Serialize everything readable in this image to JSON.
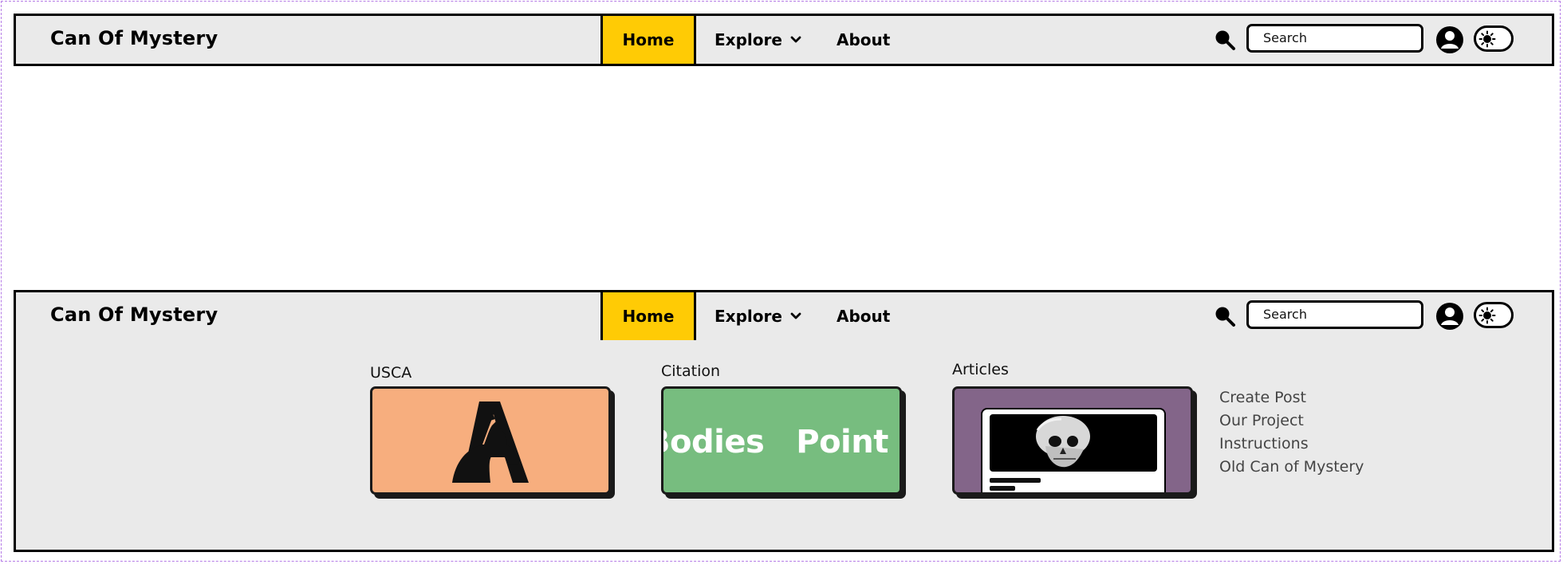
{
  "brand": "Can Of Mystery",
  "nav": {
    "home": "Home",
    "explore": "Explore",
    "about": "About"
  },
  "search": {
    "placeholder": "Search"
  },
  "icons": {
    "search": "search-icon",
    "account": "user-circle-icon",
    "theme": "sun-icon",
    "explore_caret": "chevron-down-icon"
  },
  "colors": {
    "accent": "#ffcb05",
    "nav_bg": "#eaeaea",
    "usca_card": "#f7ae7e",
    "citation_card": "#77bd7f",
    "articles_card": "#836589"
  },
  "explore_menu": {
    "cards": [
      {
        "title": "USCA"
      },
      {
        "title": "Citation",
        "marquee": [
          "Bodies",
          "Point D"
        ]
      },
      {
        "title": "Articles"
      }
    ],
    "links": [
      "Create Post",
      "Our Project",
      "Instructions",
      "Old Can of Mystery"
    ]
  }
}
